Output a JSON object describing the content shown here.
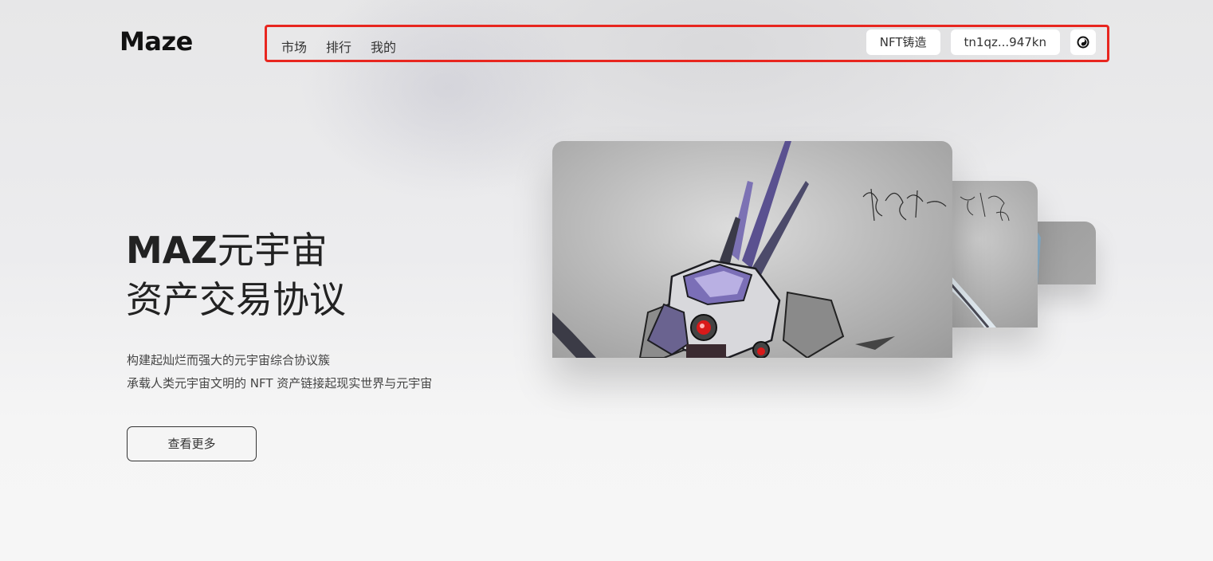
{
  "header": {
    "logo": "Maze",
    "nav": [
      {
        "label": "市场"
      },
      {
        "label": "排行"
      },
      {
        "label": "我的"
      }
    ],
    "mint_button": "NFT铸造",
    "wallet_address": "tn1qz...947kn",
    "theme_icon": "swirl-icon"
  },
  "hero": {
    "title_line1_prefix": "MAZ",
    "title_line1_rest": "元宇宙",
    "title_line2": "资产交易协议",
    "subtitle_line1": "构建起灿烂而强大的元宇宙综合协议簇",
    "subtitle_line2": "承载人类元宇宙文明的 NFT 资产链接起现实世界与元宇宙",
    "cta_button": "查看更多"
  },
  "carousel": {
    "cards": [
      {
        "subject": "purple-mecha-robot-art"
      },
      {
        "subject": "signed-artwork"
      },
      {
        "subject": "artwork"
      }
    ]
  },
  "colors": {
    "highlight_border": "#e8261f",
    "background": "#ececee"
  }
}
